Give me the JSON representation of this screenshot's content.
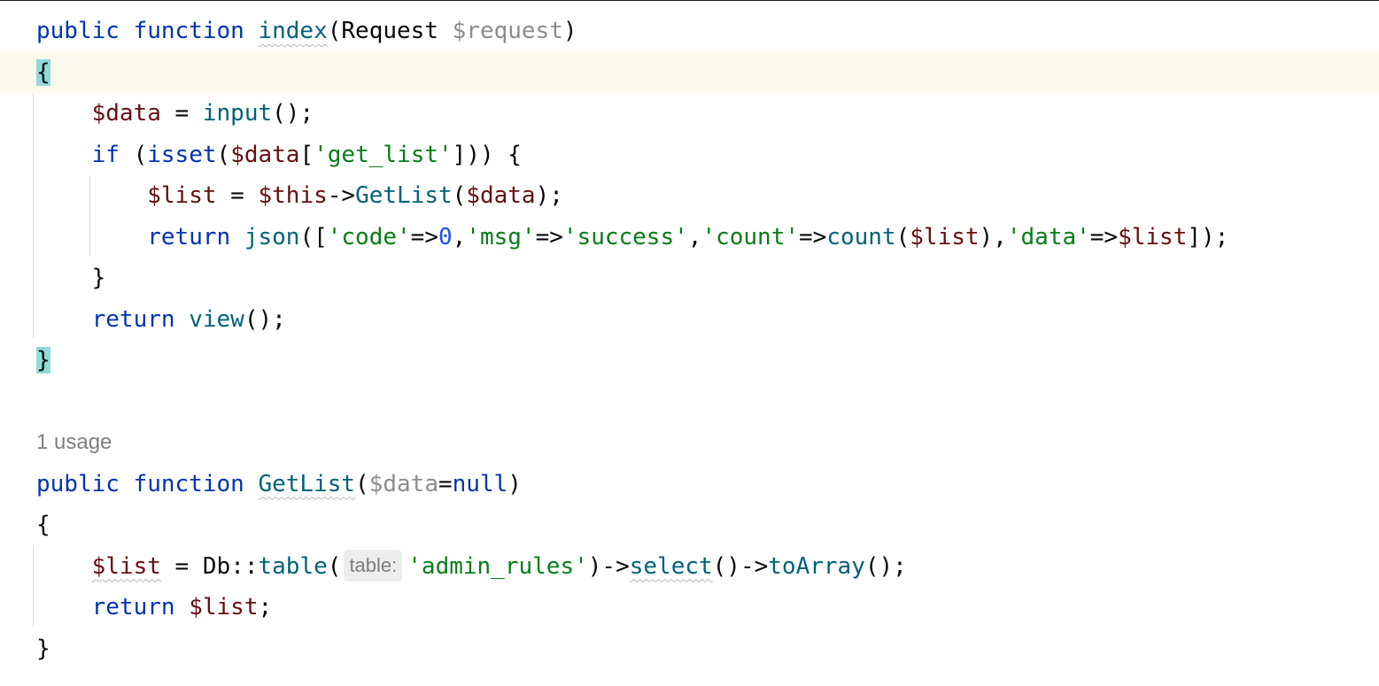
{
  "editor": {
    "lines": [
      {
        "type": "code",
        "tokens": [
          {
            "t": "public",
            "c": "kw"
          },
          {
            "t": " "
          },
          {
            "t": "function",
            "c": "kw"
          },
          {
            "t": " "
          },
          {
            "t": "index",
            "c": "fn",
            "wavy": true
          },
          {
            "t": "(",
            "c": "plain"
          },
          {
            "t": "Request",
            "c": "plain"
          },
          {
            "t": " "
          },
          {
            "t": "$request",
            "c": "dim"
          },
          {
            "t": ")",
            "c": "plain"
          }
        ]
      },
      {
        "type": "code",
        "caret": true,
        "tokens": [
          {
            "t": "{",
            "c": "plain",
            "hl": true
          }
        ]
      },
      {
        "type": "code",
        "tokens": [
          {
            "t": "    "
          },
          {
            "t": "$data",
            "c": "var"
          },
          {
            "t": " = ",
            "c": "plain"
          },
          {
            "t": "input",
            "c": "fn"
          },
          {
            "t": "();",
            "c": "plain"
          }
        ]
      },
      {
        "type": "code",
        "tokens": [
          {
            "t": "    "
          },
          {
            "t": "if",
            "c": "kw"
          },
          {
            "t": " (",
            "c": "plain"
          },
          {
            "t": "isset",
            "c": "kw"
          },
          {
            "t": "(",
            "c": "plain"
          },
          {
            "t": "$data",
            "c": "var"
          },
          {
            "t": "[",
            "c": "plain"
          },
          {
            "t": "'get_list'",
            "c": "str"
          },
          {
            "t": "])) {",
            "c": "plain"
          }
        ]
      },
      {
        "type": "code",
        "tokens": [
          {
            "t": "        "
          },
          {
            "t": "$list",
            "c": "var"
          },
          {
            "t": " = ",
            "c": "plain"
          },
          {
            "t": "$this",
            "c": "var"
          },
          {
            "t": "->",
            "c": "plain"
          },
          {
            "t": "GetList",
            "c": "fn"
          },
          {
            "t": "(",
            "c": "plain"
          },
          {
            "t": "$data",
            "c": "var"
          },
          {
            "t": ");",
            "c": "plain"
          }
        ]
      },
      {
        "type": "code",
        "tokens": [
          {
            "t": "        "
          },
          {
            "t": "return",
            "c": "kw"
          },
          {
            "t": " "
          },
          {
            "t": "json",
            "c": "fn"
          },
          {
            "t": "([",
            "c": "plain"
          },
          {
            "t": "'code'",
            "c": "str"
          },
          {
            "t": "=>",
            "c": "plain"
          },
          {
            "t": "0",
            "c": "num"
          },
          {
            "t": ",",
            "c": "plain"
          },
          {
            "t": "'msg'",
            "c": "str"
          },
          {
            "t": "=>",
            "c": "plain"
          },
          {
            "t": "'success'",
            "c": "str"
          },
          {
            "t": ",",
            "c": "plain"
          },
          {
            "t": "'count'",
            "c": "str"
          },
          {
            "t": "=>",
            "c": "plain"
          },
          {
            "t": "count",
            "c": "fn"
          },
          {
            "t": "(",
            "c": "plain"
          },
          {
            "t": "$list",
            "c": "var"
          },
          {
            "t": "),",
            "c": "plain"
          },
          {
            "t": "'data'",
            "c": "str"
          },
          {
            "t": "=>",
            "c": "plain"
          },
          {
            "t": "$list",
            "c": "var"
          },
          {
            "t": "]);",
            "c": "plain"
          }
        ]
      },
      {
        "type": "code",
        "tokens": [
          {
            "t": "    "
          },
          {
            "t": "}",
            "c": "plain"
          }
        ]
      },
      {
        "type": "code",
        "tokens": [
          {
            "t": "    "
          },
          {
            "t": "return",
            "c": "kw"
          },
          {
            "t": " "
          },
          {
            "t": "view",
            "c": "fn"
          },
          {
            "t": "();",
            "c": "plain"
          }
        ]
      },
      {
        "type": "code",
        "tokens": [
          {
            "t": "}",
            "c": "plain",
            "hl": true
          }
        ]
      },
      {
        "type": "blank",
        "tokens": []
      },
      {
        "type": "hint",
        "text": "1 usage"
      },
      {
        "type": "code",
        "tokens": [
          {
            "t": "public",
            "c": "kw"
          },
          {
            "t": " "
          },
          {
            "t": "function",
            "c": "kw"
          },
          {
            "t": " "
          },
          {
            "t": "GetList",
            "c": "fn",
            "wavy": true
          },
          {
            "t": "(",
            "c": "plain"
          },
          {
            "t": "$data",
            "c": "dim"
          },
          {
            "t": "=",
            "c": "plain"
          },
          {
            "t": "null",
            "c": "kw"
          },
          {
            "t": ")",
            "c": "plain"
          }
        ]
      },
      {
        "type": "code",
        "tokens": [
          {
            "t": "{",
            "c": "plain"
          }
        ]
      },
      {
        "type": "code",
        "tokens": [
          {
            "t": "    "
          },
          {
            "t": "$list",
            "c": "var",
            "wavy": true
          },
          {
            "t": " = ",
            "c": "plain"
          },
          {
            "t": "Db",
            "c": "plain"
          },
          {
            "t": "::",
            "c": "plain"
          },
          {
            "t": "table",
            "c": "fn"
          },
          {
            "t": "(",
            "c": "plain"
          },
          {
            "inlay": "table:"
          },
          {
            "t": "'admin_rules'",
            "c": "str"
          },
          {
            "t": ")->",
            "c": "plain"
          },
          {
            "t": "select",
            "c": "fn",
            "wavy": true
          },
          {
            "t": "()->",
            "c": "plain"
          },
          {
            "t": "toArray",
            "c": "fn"
          },
          {
            "t": "();",
            "c": "plain"
          }
        ]
      },
      {
        "type": "code",
        "tokens": [
          {
            "t": "    "
          },
          {
            "t": "return",
            "c": "kw"
          },
          {
            "t": " "
          },
          {
            "t": "$list",
            "c": "var"
          },
          {
            "t": ";",
            "c": "plain"
          }
        ]
      },
      {
        "type": "code",
        "tokens": [
          {
            "t": "}",
            "c": "plain"
          }
        ]
      }
    ]
  }
}
